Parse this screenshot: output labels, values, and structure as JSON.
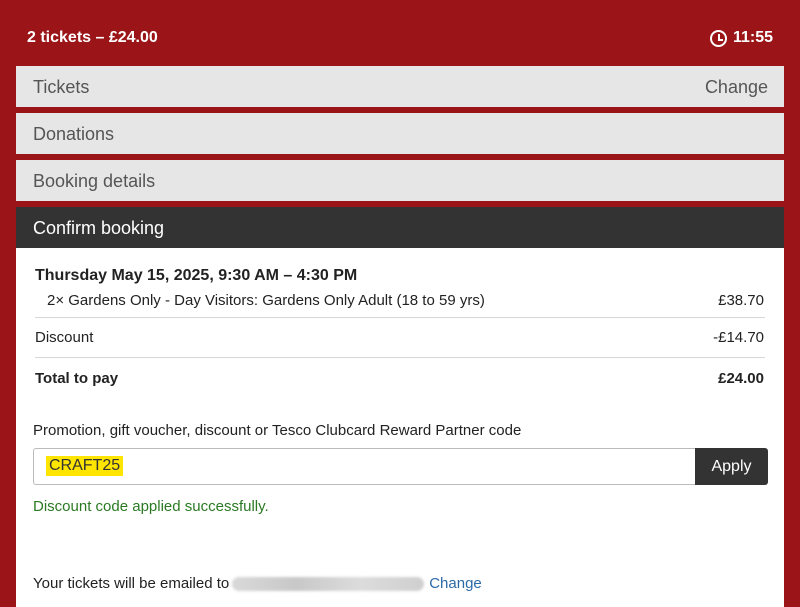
{
  "header": {
    "summary": "2 tickets – £24.00",
    "timer": "11:55"
  },
  "steps": {
    "tickets": {
      "label": "Tickets",
      "change": "Change"
    },
    "donations": {
      "label": "Donations"
    },
    "booking_details": {
      "label": "Booking details"
    },
    "confirm": {
      "label": "Confirm booking"
    }
  },
  "booking": {
    "date": "Thursday May 15, 2025, 9:30 AM – 4:30 PM",
    "item": {
      "description": "2× Gardens Only - Day Visitors: Gardens Only Adult (18 to 59 yrs)",
      "price": "£38.70"
    },
    "discount": {
      "label": "Discount",
      "value": "-£14.70"
    },
    "total": {
      "label": "Total to pay",
      "value": "£24.00"
    }
  },
  "promo": {
    "label": "Promotion, gift voucher, discount or Tesco Clubcard Reward Partner code",
    "value": "CRAFT25",
    "apply_label": "Apply",
    "success": "Discount code applied successfully."
  },
  "email": {
    "prefix": "Your tickets will be emailed to",
    "change": "Change"
  },
  "colors": {
    "brand": "#9b1518",
    "dark": "#333333",
    "success": "#2a7a23",
    "link": "#2b6aa8",
    "highlight": "#ffe500"
  }
}
